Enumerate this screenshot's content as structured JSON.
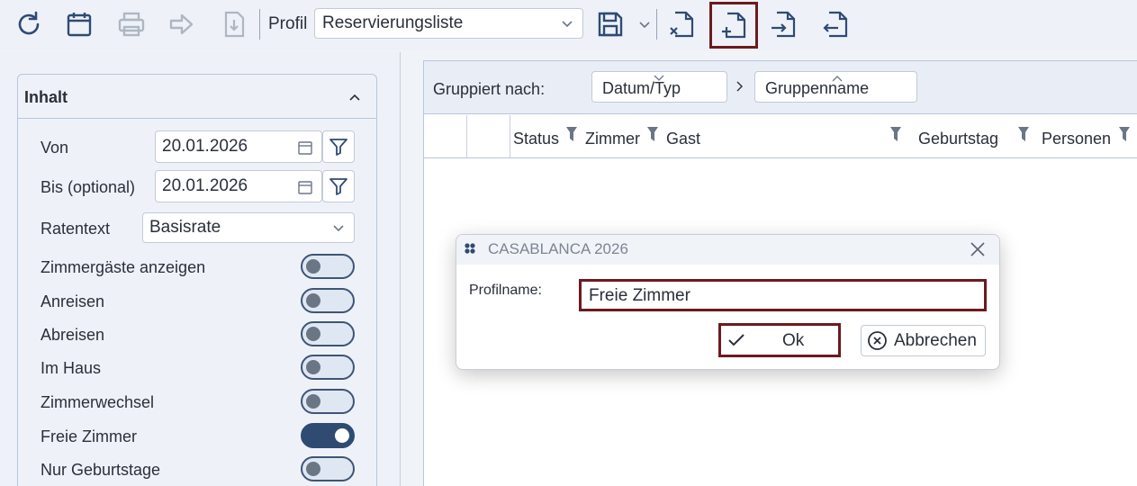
{
  "toolbar": {
    "refresh_icon": "refresh-icon",
    "calendar_icon": "calendar-icon",
    "print_icon": "printer-icon",
    "forward_icon": "arrow-right-icon",
    "export_icon": "download-file-icon",
    "profile_label": "Profil",
    "profile_value": "Reservierungsliste",
    "save_icon": "save-icon",
    "delete_profile_icon": "file-x-icon",
    "new_profile_icon": "file-plus-icon",
    "import_icon": "file-import-icon",
    "export_profile_icon": "file-export-icon",
    "highlight_color": "#6b1a1f"
  },
  "panel": {
    "title": "Inhalt",
    "von_label": "Von",
    "von_value": "20.01.2026",
    "bis_label": "Bis (optional)",
    "bis_value": "20.01.2026",
    "rate_label": "Ratentext",
    "rate_value": "Basisrate",
    "toggles": [
      {
        "label": "Zimmergäste anzeigen",
        "on": false
      },
      {
        "label": "Anreisen",
        "on": false
      },
      {
        "label": "Abreisen",
        "on": false
      },
      {
        "label": "Im Haus",
        "on": false
      },
      {
        "label": "Zimmerwechsel",
        "on": false
      },
      {
        "label": "Freie Zimmer",
        "on": true
      },
      {
        "label": "Nur Geburtstage",
        "on": false
      }
    ]
  },
  "grouping": {
    "label": "Gruppiert nach:",
    "chips": [
      "Datum/Typ",
      "Gruppenname"
    ]
  },
  "grid": {
    "columns": [
      "Status",
      "Zimmer",
      "Gast",
      "Geburtstag",
      "Personen"
    ]
  },
  "dialog": {
    "title": "CASABLANCA 2026",
    "field_label": "Profilname:",
    "field_value": "Freie Zimmer",
    "ok_label": "Ok",
    "cancel_label": "Abbrechen"
  }
}
